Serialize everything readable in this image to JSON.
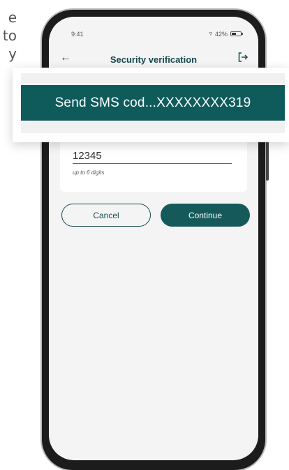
{
  "background_text": [
    "e",
    "to",
    "y"
  ],
  "status_bar": {
    "time": "9:41",
    "battery": "42%"
  },
  "header": {
    "title": "Security verification",
    "back_icon": "arrow-left-icon",
    "logout_icon": "logout-icon"
  },
  "form": {
    "code_value": "12345",
    "hint": "up to 6 digits"
  },
  "buttons": {
    "cancel": "Cancel",
    "continue": "Continue"
  },
  "toast": {
    "message": "Send SMS cod...XXXXXXXX319"
  },
  "colors": {
    "brand": "#16595b",
    "banner": "#0f5b5c",
    "screen_bg": "#f4f4f4"
  }
}
